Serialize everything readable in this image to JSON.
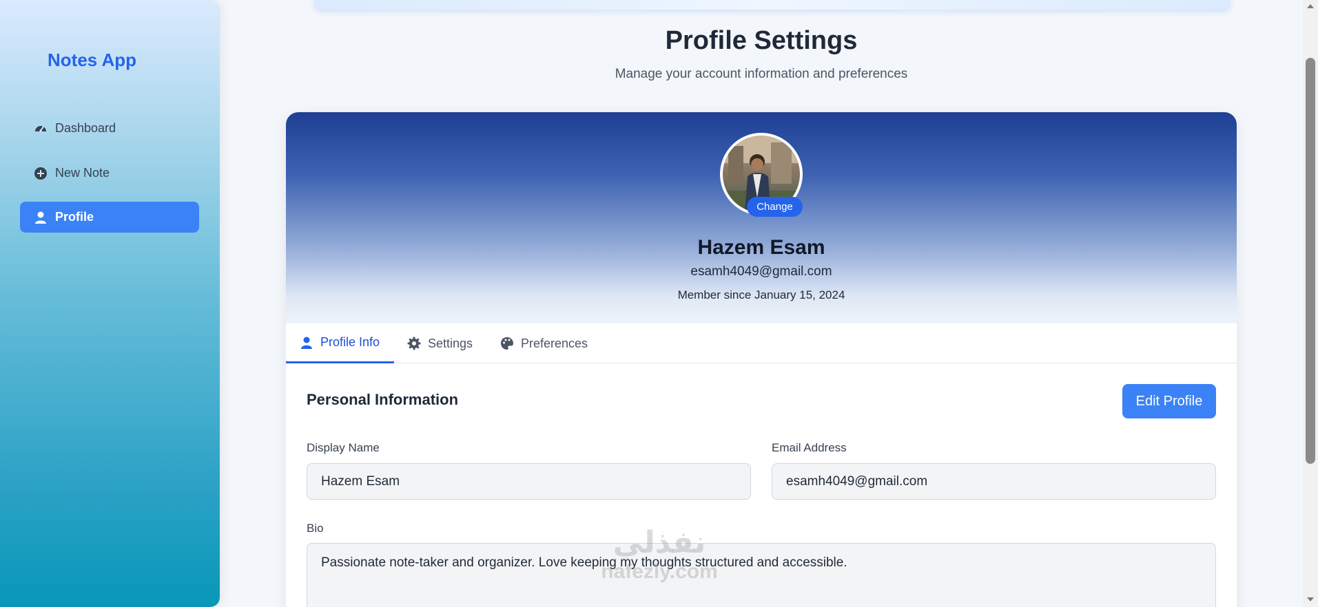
{
  "sidebar": {
    "brand": "Notes App",
    "items": [
      {
        "label": "Dashboard",
        "icon": "dashboard-gauge-icon"
      },
      {
        "label": "New Note",
        "icon": "plus-circle-icon"
      },
      {
        "label": "Profile",
        "icon": "user-icon",
        "active": true
      }
    ]
  },
  "header": {
    "title": "Profile Settings",
    "subtitle": "Manage your account information and preferences"
  },
  "profile": {
    "change_label": "Change",
    "name": "Hazem Esam",
    "email": "esamh4049@gmail.com",
    "member_since": "Member since January 15, 2024"
  },
  "tabs": [
    {
      "label": "Profile Info",
      "icon": "user-icon",
      "active": true
    },
    {
      "label": "Settings",
      "icon": "gear-icon"
    },
    {
      "label": "Preferences",
      "icon": "palette-icon"
    }
  ],
  "personal": {
    "title": "Personal Information",
    "edit_label": "Edit Profile",
    "display_name_label": "Display Name",
    "display_name_value": "Hazem Esam",
    "email_label": "Email Address",
    "email_value": "esamh4049@gmail.com",
    "bio_label": "Bio",
    "bio_value": "Passionate note-taker and organizer. Love keeping my thoughts structured and accessible."
  },
  "watermark": {
    "arabic": "نفذلي",
    "latin": "nafezly.com"
  },
  "colors": {
    "accent": "#3b82f6",
    "brand": "#2563eb",
    "hero_dark": "#1e3f94"
  }
}
